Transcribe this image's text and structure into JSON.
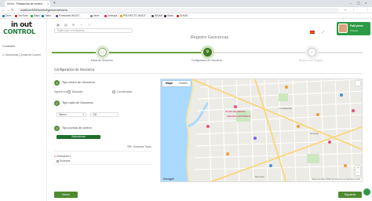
{
  "browser": {
    "tab_title": "InOut - Plataforma de control...",
    "url": "localhost:5000/control/geocerca/nueva",
    "bookmarks": [
      {
        "label": "Drive",
        "color": "#1a73e8"
      },
      {
        "label": "YouTube",
        "color": "#e62117"
      },
      {
        "label": "Maps",
        "color": "#34a853"
      },
      {
        "label": "Trello",
        "color": "#0079bf"
      },
      {
        "label": "Formulario INOUT...",
        "color": "#673ab7"
      },
      {
        "label": "Inicio",
        "color": "#888888"
      },
      {
        "label": "Animaps",
        "color": "#e91e63"
      },
      {
        "label": "PROYECTO INOUT...",
        "color": "#ff9800"
      },
      {
        "label": "INDAB",
        "color": "#555555"
      },
      {
        "label": "Slack",
        "color": "#4a154b"
      },
      {
        "label": "SUNAT",
        "color": "#c62828"
      }
    ]
  },
  "brand": {
    "line1": "in out",
    "line2": "CONTROL",
    "accent": "#1f7a3a"
  },
  "sidebar": {
    "title": "Controles",
    "items": [
      "Geocercas | Zonas de Control"
    ]
  },
  "topbar": {
    "search_placeholder": "Digite aquí su búsqueda...",
    "user_name": "Fabi perez",
    "user_role": "Usuario"
  },
  "page": {
    "title": "Registro Geocercas"
  },
  "stepper": {
    "steps": [
      {
        "label": "Datos de Geocerca",
        "state": "done"
      },
      {
        "label": "Configuración de Geocerca",
        "state": "active"
      },
      {
        "label": "Resumen de Registro",
        "state": "pending"
      }
    ]
  },
  "form": {
    "section_title": "Configuracion de Geocerca",
    "q1": {
      "num": "1",
      "label": "Tipo centro de Geocerca",
      "row_label": "Ingrese con:",
      "options": [
        "Buscador",
        "Coordenadas"
      ]
    },
    "q2": {
      "num": "2",
      "label": "Tipo radio de Geocerca",
      "select_value": "Metros",
      "input_value": "100"
    },
    "q3": {
      "num": "3",
      "label": "Tipo puntos de control",
      "button": "Seleccionar",
      "toggle_label": "Escanear Todos",
      "checkpoints": [
        "Checkpoint 1",
        "Escanear"
      ]
    }
  },
  "map": {
    "tabs": [
      "Mapa",
      "Satélite"
    ],
    "attribution": "Datos del mapa ©2022  Términos de uso  Informar un error",
    "logo": "Google",
    "places": [
      "PLAZA DE ARMAS",
      "CENTRO HISTÓRICO",
      "LA MERCED",
      "Hospital",
      "Mercado"
    ]
  },
  "footer": {
    "prev": "Volver",
    "next": "Siguiente"
  }
}
